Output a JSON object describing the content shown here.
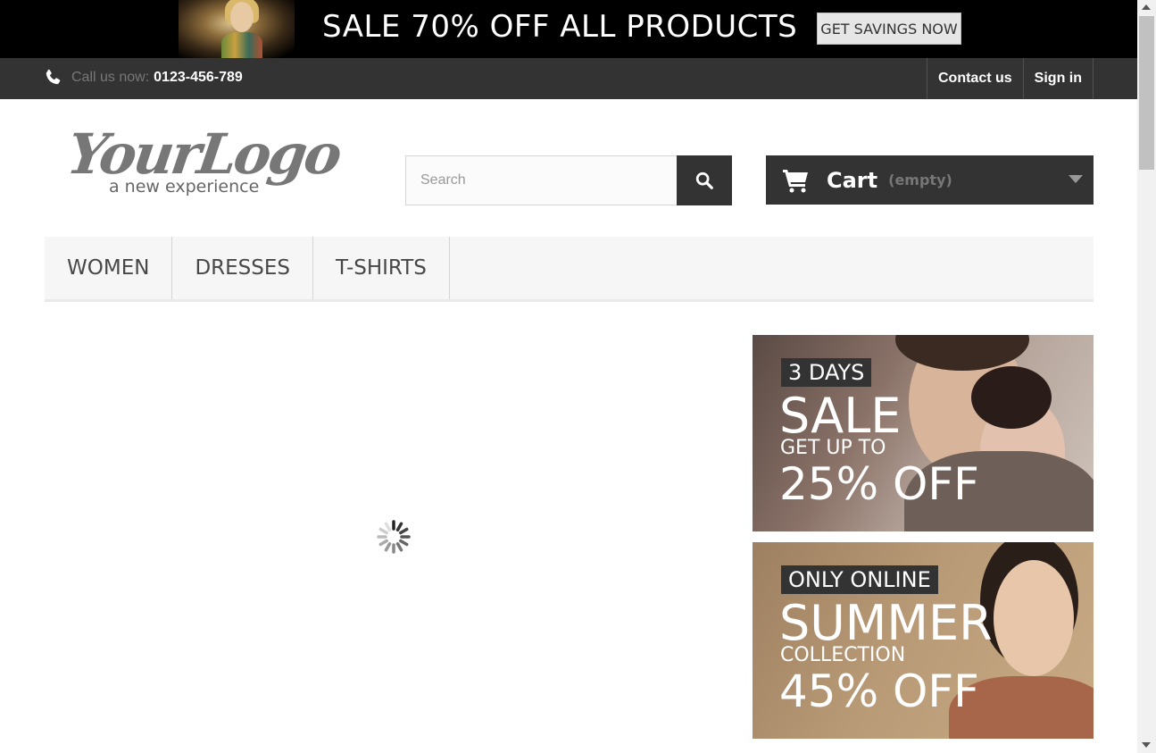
{
  "promo": {
    "title": "SALE 70% OFF ALL PRODUCTS",
    "button_label": "GET SAVINGS NOW"
  },
  "topbar": {
    "call_label": "Call us now:",
    "phone": "0123-456-789",
    "contact_label": "Contact us",
    "signin_label": "Sign in"
  },
  "header": {
    "logo_text": "YourLogo",
    "logo_tagline": "a new experience",
    "search_placeholder": "Search",
    "cart_label": "Cart",
    "cart_state": "(empty)"
  },
  "menu": {
    "items": [
      {
        "label": "WOMEN"
      },
      {
        "label": "DRESSES"
      },
      {
        "label": "T-SHIRTS"
      }
    ]
  },
  "banners": [
    {
      "tag": "3 DAYS",
      "headline": "SALE",
      "subline": "GET UP TO",
      "discount": "25% OFF"
    },
    {
      "tag": "ONLY ONLINE",
      "headline": "SUMMER",
      "subline": "COLLECTION",
      "discount": "45% OFF"
    }
  ],
  "colors": {
    "dark": "#333333",
    "promo_bg": "#000000",
    "menu_bg": "#f6f6f6",
    "muted_text": "#777777"
  },
  "icons": {
    "phone": "phone-icon",
    "search": "search-icon",
    "cart": "cart-icon",
    "loading": "loading-spinner-icon"
  }
}
